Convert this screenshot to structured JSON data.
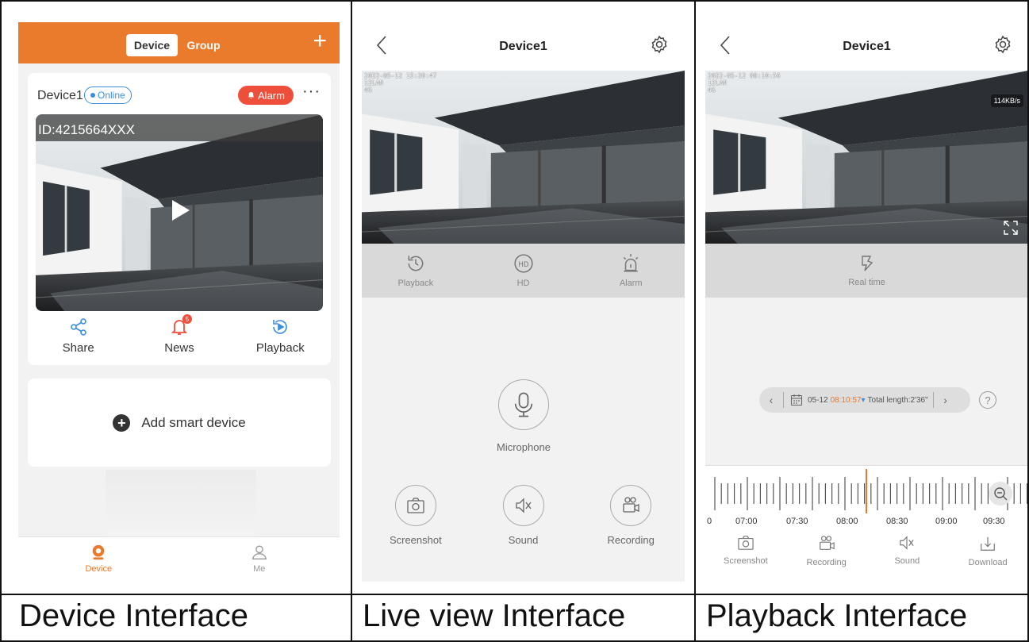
{
  "captions": {
    "device": "Device Interface",
    "live": "Live view Interface",
    "playback": "Playback Interface"
  },
  "device_screen": {
    "segments": {
      "device": "Device",
      "group": "Group"
    },
    "add_icon": "plus-icon",
    "card": {
      "name": "Device1",
      "status": "Online",
      "alarm_label": "Alarm",
      "more": "···",
      "device_id": "ID:4215664XXX",
      "actions": [
        {
          "label": "Share",
          "icon": "share-icon"
        },
        {
          "label": "News",
          "icon": "bell-icon",
          "badge": "5"
        },
        {
          "label": "Playback",
          "icon": "playback-icon"
        }
      ]
    },
    "add_device": "Add smart device",
    "tabs": [
      {
        "label": "Device",
        "icon": "camera-icon",
        "active": true
      },
      {
        "label": "Me",
        "icon": "user-icon",
        "active": false
      }
    ],
    "accent": "#ea7a2c",
    "alarm_color": "#ee4f3a",
    "online_color": "#3b8de0"
  },
  "live_screen": {
    "title": "Device1",
    "osd": {
      "datetime": "2022-05-12 15:20:47",
      "line2": "12LAN",
      "signal": "4G"
    },
    "controls": [
      {
        "label": "Playback",
        "icon": "history-icon"
      },
      {
        "label": "HD",
        "icon": "hd-icon"
      },
      {
        "label": "Alarm",
        "icon": "siren-icon"
      }
    ],
    "microphone": "Microphone",
    "buttons": [
      {
        "label": "Screenshot",
        "icon": "camera-icon"
      },
      {
        "label": "Sound",
        "icon": "mute-icon"
      },
      {
        "label": "Recording",
        "icon": "video-recorder-icon"
      }
    ]
  },
  "playback_screen": {
    "title": "Device1",
    "osd": {
      "datetime": "2022-05-12 08:10:56",
      "line2": "12LAN",
      "signal": "4G"
    },
    "speed": "114KB/s",
    "real_time": "Real time",
    "date_bar": {
      "date": "05-12",
      "time": "08:10:57",
      "caret": "▾",
      "total": "Total length:2'36\""
    },
    "help": "?",
    "timeline_labels": [
      "0",
      "07:00",
      "07:30",
      "08:00",
      "08:30",
      "09:00",
      "09:30"
    ],
    "bottom": [
      {
        "label": "Screenshot",
        "icon": "camera-icon"
      },
      {
        "label": "Recording",
        "icon": "video-recorder-icon"
      },
      {
        "label": "Sound",
        "icon": "mute-icon"
      },
      {
        "label": "Download",
        "icon": "download-icon"
      }
    ]
  }
}
